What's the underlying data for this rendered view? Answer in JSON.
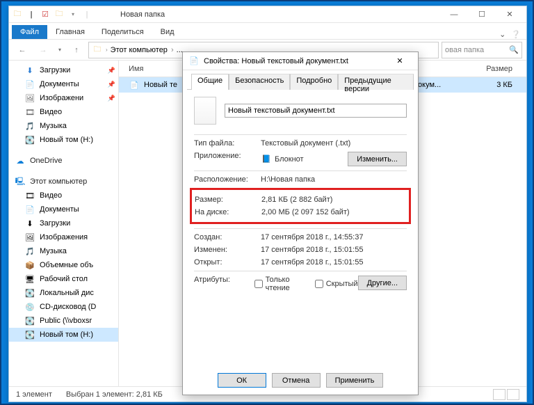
{
  "window": {
    "title": "Новая папка",
    "tabs": {
      "file": "Файл",
      "home": "Главная",
      "share": "Поделиться",
      "view": "Вид"
    }
  },
  "address": {
    "crumbs": [
      "Этот компьютер",
      "..."
    ],
    "search_placeholder": "овая папка"
  },
  "nav": {
    "quick": [
      {
        "label": "Загрузки",
        "icon": "⬇",
        "pinned": true,
        "color": "#2b7cd3"
      },
      {
        "label": "Документы",
        "icon": "📄",
        "pinned": true
      },
      {
        "label": "Изображени",
        "icon": "🖼",
        "pinned": true
      },
      {
        "label": "Видео",
        "icon": "🎞",
        "pinned": false
      },
      {
        "label": "Музыка",
        "icon": "🎵",
        "pinned": false
      },
      {
        "label": "Новый том (H:)",
        "icon": "💽",
        "pinned": false
      }
    ],
    "onedrive": "OneDrive",
    "thispc": "Этот компьютер",
    "pc": [
      {
        "label": "Видео",
        "icon": "🎞"
      },
      {
        "label": "Документы",
        "icon": "📄"
      },
      {
        "label": "Загрузки",
        "icon": "⬇"
      },
      {
        "label": "Изображения",
        "icon": "🖼"
      },
      {
        "label": "Музыка",
        "icon": "🎵"
      },
      {
        "label": "Объемные объ",
        "icon": "📦"
      },
      {
        "label": "Рабочий стол",
        "icon": "🖥"
      },
      {
        "label": "Локальный дис",
        "icon": "💽"
      },
      {
        "label": "CD-дисковод (D",
        "icon": "💿"
      },
      {
        "label": "Public (\\\\vboxsr",
        "icon": "💽"
      },
      {
        "label": "Новый том (H:)",
        "icon": "💽",
        "selected": true
      }
    ]
  },
  "columns": {
    "name": "Имя",
    "size": "Размер"
  },
  "file": {
    "name": "Новый те",
    "type_col": "окум...",
    "size": "3 КБ"
  },
  "status": {
    "count": "1 элемент",
    "selection": "Выбран 1 элемент: 2,81 КБ"
  },
  "dialog": {
    "title": "Свойства: Новый текстовый документ.txt",
    "tabs": {
      "general": "Общие",
      "security": "Безопасность",
      "details": "Подробно",
      "prev": "Предыдущие версии"
    },
    "filename": "Новый текстовый документ.txt",
    "rows": {
      "type_lbl": "Тип файла:",
      "type_val": "Текстовый документ (.txt)",
      "app_lbl": "Приложение:",
      "app_val": "Блокнот",
      "change_btn": "Изменить...",
      "loc_lbl": "Расположение:",
      "loc_val": "H:\\Новая папка",
      "size_lbl": "Размер:",
      "size_val": "2,81 КБ (2 882 байт)",
      "disk_lbl": "На диске:",
      "disk_val": "2,00 МБ (2 097 152 байт)",
      "created_lbl": "Создан:",
      "created_val": "17 сентября 2018 г., 14:55:37",
      "modified_lbl": "Изменен:",
      "modified_val": "17 сентября 2018 г., 15:01:55",
      "opened_lbl": "Открыт:",
      "opened_val": "17 сентября 2018 г., 15:01:55",
      "attr_lbl": "Атрибуты:",
      "readonly": "Только чтение",
      "hidden": "Скрытый",
      "other_btn": "Другие..."
    },
    "buttons": {
      "ok": "ОК",
      "cancel": "Отмена",
      "apply": "Применить"
    }
  }
}
